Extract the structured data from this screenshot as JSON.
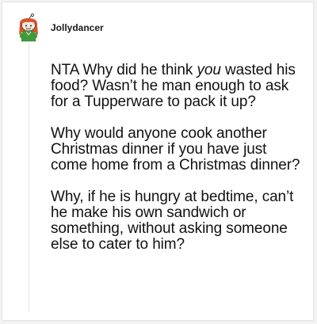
{
  "comment": {
    "username": "Jollydancer",
    "avatar_icon": "snoo-avatar-red-hair-green-outfit-icon",
    "paragraph1": {
      "before": "NTA Why did he think ",
      "emphasis": "you",
      "after": " wasted his food? Wasn’t he man enough to ask for a Tupperware to pack it up?"
    },
    "paragraph2": "Why would anyone cook another Christmas dinner if you have just come home from a Christmas dinner?",
    "paragraph3": "Why, if he is hungry at bedtime, can’t he make his own sandwich or something, without asking someone else to cater to him?"
  },
  "colors": {
    "page_background": "#f3f3f3",
    "card_background": "#ffffff",
    "avatar_hair": "#d9532b",
    "avatar_outfit": "#3e9b3a",
    "thread_line": "#e3e3e3"
  }
}
